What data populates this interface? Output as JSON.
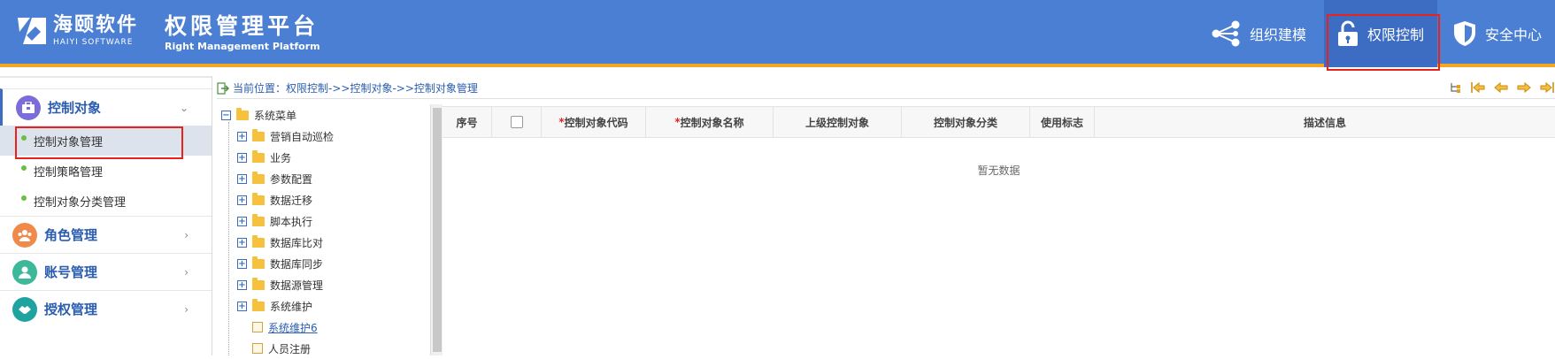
{
  "brand": {
    "company_cn": "海颐软件",
    "company_en": "HAIYI SOFTWARE",
    "platform_cn": "权限管理平台",
    "platform_en": "Right Management Platform"
  },
  "top_nav": [
    {
      "label": "组织建模",
      "icon": "share-nodes-icon"
    },
    {
      "label": "权限控制",
      "icon": "unlock-icon",
      "active": true
    },
    {
      "label": "安全中心",
      "icon": "shield-icon"
    }
  ],
  "sidebar": {
    "groups": [
      {
        "label": "控制对象",
        "icon": "briefcase-icon",
        "color": "#7b6cd9",
        "expanded": true,
        "items": [
          {
            "label": "控制对象管理",
            "selected": true
          },
          {
            "label": "控制策略管理"
          },
          {
            "label": "控制对象分类管理"
          }
        ]
      },
      {
        "label": "角色管理",
        "icon": "group-icon",
        "color": "#f08a4b"
      },
      {
        "label": "账号管理",
        "icon": "user-icon",
        "color": "#3db89b"
      },
      {
        "label": "授权管理",
        "icon": "handshake-icon",
        "color": "#1fa3a0"
      }
    ]
  },
  "breadcrumb": "当前位置：权限控制->>控制对象->>控制对象管理",
  "tree": {
    "root": "系统菜单",
    "children": [
      {
        "label": "营销自动巡检",
        "type": "folder"
      },
      {
        "label": "业务",
        "type": "folder"
      },
      {
        "label": "参数配置",
        "type": "folder"
      },
      {
        "label": "数据迁移",
        "type": "folder"
      },
      {
        "label": "脚本执行",
        "type": "folder"
      },
      {
        "label": "数据库比对",
        "type": "folder"
      },
      {
        "label": "数据库同步",
        "type": "folder"
      },
      {
        "label": "数据源管理",
        "type": "folder"
      },
      {
        "label": "系统维护",
        "type": "folder"
      },
      {
        "label": "系统维护6",
        "type": "leaf"
      },
      {
        "label": "人员注册",
        "type": "leaf"
      }
    ]
  },
  "table": {
    "columns": [
      {
        "label": "序号"
      },
      {
        "label": "",
        "checkbox": true
      },
      {
        "label": "控制对象代码",
        "required": true
      },
      {
        "label": "控制对象名称",
        "required": true
      },
      {
        "label": "上级控制对象"
      },
      {
        "label": "控制对象分类"
      },
      {
        "label": "使用标志"
      },
      {
        "label": "描述信息"
      }
    ],
    "empty_text": "暂无数据"
  }
}
